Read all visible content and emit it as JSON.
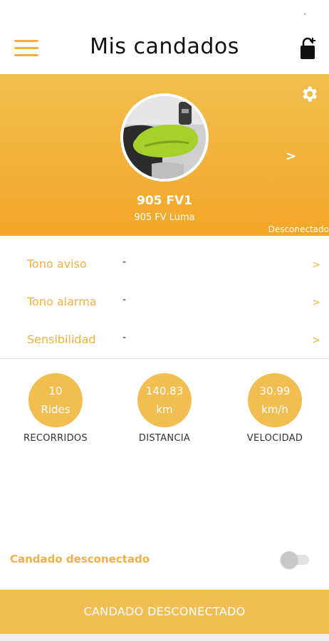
{
  "appbar": {
    "title": "Mis candados",
    "menu_icon": "hamburger-menu-icon",
    "add_icon": "lock-add-icon"
  },
  "hero": {
    "settings_icon": "gear-icon",
    "lock_name": "905 FV1",
    "lock_model": "905 FV Luma",
    "chevron": ">",
    "connection_status": "Desconectado"
  },
  "settings": {
    "rows": [
      {
        "label": "Tono aviso",
        "value": "-",
        "chevron": ">"
      },
      {
        "label": "Tono alarma",
        "value": "-",
        "chevron": ">"
      },
      {
        "label": "Sensibilidad",
        "value": "-",
        "chevron": ">"
      }
    ]
  },
  "stats": [
    {
      "value": "10",
      "unit": "Rides",
      "caption": "RECORRIDOS"
    },
    {
      "value": "140.83",
      "unit": "km",
      "caption": "DISTANCIA"
    },
    {
      "value": "30.99",
      "unit": "km/h",
      "caption": "VELOCIDAD"
    }
  ],
  "toggle": {
    "label": "Candado desconectado",
    "state": "off"
  },
  "bottom_button": {
    "label": "CANDADO DESCONECTADO"
  },
  "colors": {
    "accent": "#F2B03D",
    "hero_top": "#F1BE4E",
    "hero_bottom": "#F3A728",
    "stat_circle": "#F2BE52",
    "lock_green": "#A6D02A"
  }
}
